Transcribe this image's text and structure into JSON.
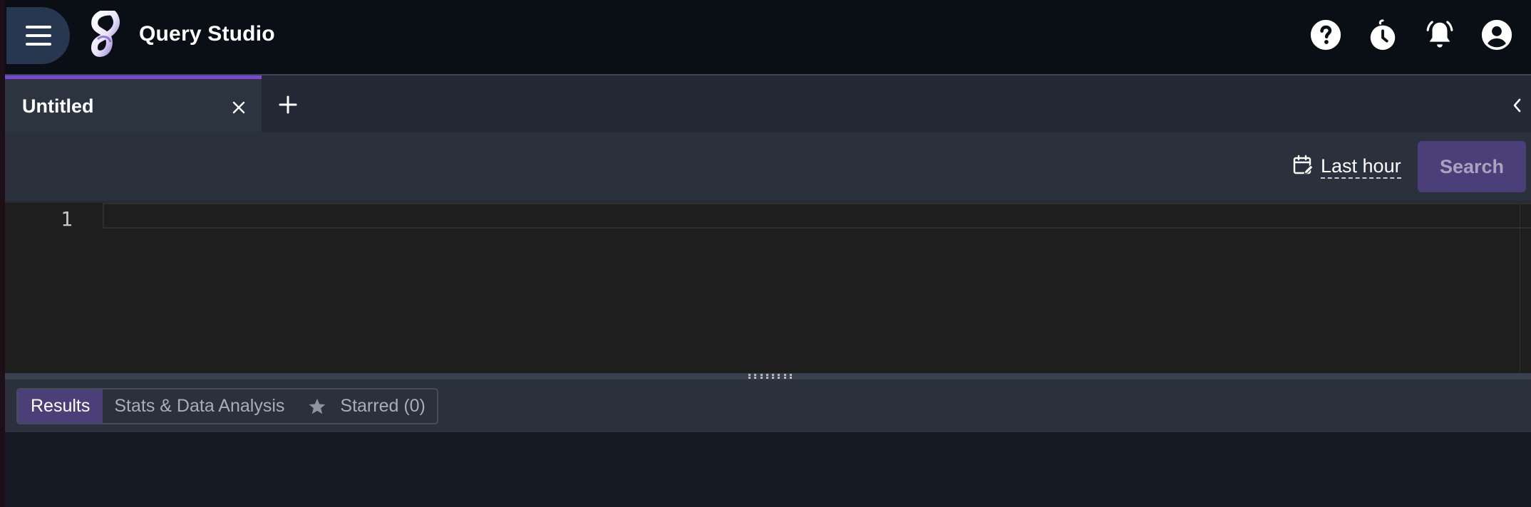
{
  "header": {
    "app_title": "Query Studio",
    "menu_icon": "hamburger-menu-icon",
    "logo_icon": "app-logo",
    "icons": [
      "help-icon",
      "timer-icon",
      "notifications-bell-icon",
      "account-circle-icon"
    ]
  },
  "tabs": {
    "items": [
      {
        "label": "Untitled",
        "active": true
      }
    ],
    "close_icon": "close-icon",
    "add_icon": "plus-icon",
    "collapse_icon": "chevron-left-icon"
  },
  "toolbar": {
    "time_range_label": "Last hour",
    "time_range_icon": "calendar-edit-icon",
    "search_label": "Search"
  },
  "editor": {
    "line_numbers": [
      "1"
    ],
    "content": ""
  },
  "results": {
    "tabs": [
      {
        "label": "Results",
        "active": true
      },
      {
        "label": "Stats & Data Analysis",
        "active": false
      },
      {
        "label": "Starred (0)",
        "active": false,
        "icon": "star-icon"
      }
    ]
  },
  "colors": {
    "accent": "#7b49d6",
    "primary_button": "#4b3f7a",
    "header_bg": "#0a0e15",
    "editor_bg": "#1e1e1e"
  }
}
